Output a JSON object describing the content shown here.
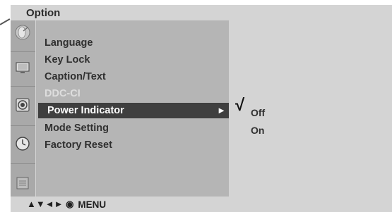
{
  "menu": {
    "title": "Option",
    "items": [
      {
        "label": "Language",
        "state": "normal"
      },
      {
        "label": "Key Lock",
        "state": "normal"
      },
      {
        "label": "Caption/Text",
        "state": "normal"
      },
      {
        "label": "DDC-CI",
        "state": "disabled"
      },
      {
        "label": "Power Indicator",
        "state": "selected"
      },
      {
        "label": "Mode Setting",
        "state": "normal"
      },
      {
        "label": "Factory Reset",
        "state": "normal"
      }
    ],
    "submenu_arrow": "►"
  },
  "submenu": {
    "check_mark": "√",
    "options": [
      {
        "label": "Off",
        "checked": true
      },
      {
        "label": "On",
        "checked": false
      }
    ]
  },
  "sidebar": {
    "icons": [
      {
        "name": "satellite-dish-icon"
      },
      {
        "name": "monitor-icon"
      },
      {
        "name": "speaker-icon"
      },
      {
        "name": "clock-icon"
      },
      {
        "name": "settings-panel-icon",
        "active": true
      }
    ]
  },
  "footer": {
    "keys": "▲▼◄► ◉",
    "menu_label": "MENU"
  },
  "colors": {
    "background_light": "#d4d4d4",
    "menu_column": "#b5b5b5",
    "icon_column": "#a9a9a9",
    "selection": "#3f3f3f",
    "text": "#303030",
    "disabled_text": "#dedede"
  }
}
